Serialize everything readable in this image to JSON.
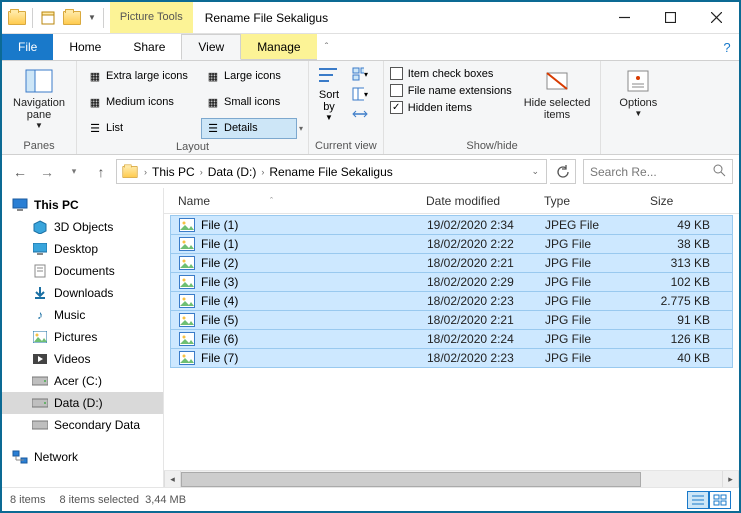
{
  "titlebar": {
    "context_tool": "Picture Tools",
    "title": "Rename File Sekaligus"
  },
  "ribbon_tabs": {
    "file": "File",
    "home": "Home",
    "share": "Share",
    "view": "View",
    "manage": "Manage"
  },
  "ribbon": {
    "panes": {
      "nav_pane": "Navigation\npane",
      "label": "Panes"
    },
    "layout": {
      "extra_large": "Extra large icons",
      "large": "Large icons",
      "medium": "Medium icons",
      "small": "Small icons",
      "list": "List",
      "details": "Details",
      "label": "Layout"
    },
    "current_view": {
      "sort_by": "Sort\nby",
      "label": "Current view"
    },
    "show_hide": {
      "item_check": "Item check boxes",
      "file_ext": "File name extensions",
      "hidden": "Hidden items",
      "hide_selected": "Hide selected\nitems",
      "label": "Show/hide"
    },
    "options": "Options"
  },
  "breadcrumb": {
    "this_pc": "This PC",
    "drive": "Data (D:)",
    "folder": "Rename File Sekaligus"
  },
  "search_placeholder": "Search Re...",
  "tree": {
    "this_pc": "This PC",
    "objects3d": "3D Objects",
    "desktop": "Desktop",
    "documents": "Documents",
    "downloads": "Downloads",
    "music": "Music",
    "pictures": "Pictures",
    "videos": "Videos",
    "acer": "Acer (C:)",
    "data": "Data  (D:)",
    "secondary": "Secondary Data",
    "network": "Network"
  },
  "columns": {
    "name": "Name",
    "date": "Date modified",
    "type": "Type",
    "size": "Size"
  },
  "files": [
    {
      "name": "File (1)",
      "date": "19/02/2020 2:34",
      "type": "JPEG File",
      "size": "49 KB"
    },
    {
      "name": "File (1)",
      "date": "18/02/2020 2:22",
      "type": "JPG File",
      "size": "38 KB"
    },
    {
      "name": "File (2)",
      "date": "18/02/2020 2:21",
      "type": "JPG File",
      "size": "313 KB"
    },
    {
      "name": "File (3)",
      "date": "18/02/2020 2:29",
      "type": "JPG File",
      "size": "102 KB"
    },
    {
      "name": "File (4)",
      "date": "18/02/2020 2:23",
      "type": "JPG File",
      "size": "2.775 KB"
    },
    {
      "name": "File (5)",
      "date": "18/02/2020 2:21",
      "type": "JPG File",
      "size": "91 KB"
    },
    {
      "name": "File (6)",
      "date": "18/02/2020 2:24",
      "type": "JPG File",
      "size": "126 KB"
    },
    {
      "name": "File (7)",
      "date": "18/02/2020 2:23",
      "type": "JPG File",
      "size": "40 KB"
    }
  ],
  "status": {
    "count": "8 items",
    "selected": "8 items selected",
    "size": "3,44 MB"
  }
}
